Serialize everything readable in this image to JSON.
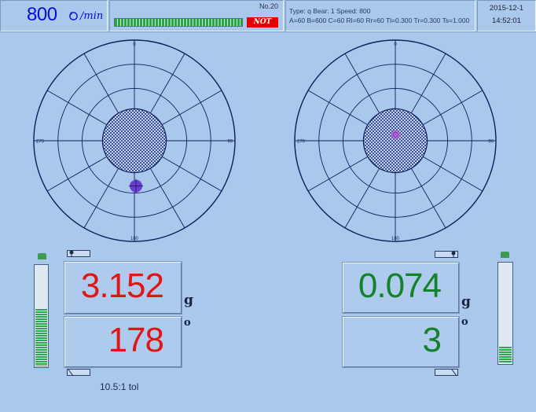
{
  "header": {
    "speed_value": "800",
    "speed_unit": "/min",
    "no_label": "No.20",
    "progress": 1.0,
    "status_badge": "NOT",
    "info_line1": "Type: q      Bear: 1      Speed: 800",
    "info_line2": "A=60 B=600 C=60 Rl=60 Rr=60 Tl=0.300 Tr=0.300 Ts=1.000",
    "date": "2015-12-1",
    "time": "14:52:01"
  },
  "left_plane": {
    "labels": {
      "top": "0",
      "right": "90",
      "bottom": "180",
      "left": "270"
    },
    "amount": "3.152",
    "angle": "178",
    "amount_unit": "g",
    "angle_unit": "o",
    "meter_level": 0.58,
    "marker": {
      "angle_deg": 178,
      "radius_fraction": 0.45
    },
    "tolerance_label": "10.5:1 tol"
  },
  "right_plane": {
    "labels": {
      "top": "0",
      "right": "90",
      "bottom": "180",
      "left": "270"
    },
    "amount": "0.074",
    "angle": "3",
    "amount_unit": "g",
    "angle_unit": "o",
    "meter_level": 0.18,
    "marker": {
      "angle_deg": 3,
      "radius_fraction": 0.06
    }
  },
  "colors": {
    "background": "#a9c8ec",
    "polar_lines": "#0f1f5c",
    "amount_left": "#e01515",
    "amount_right": "#13822a",
    "marker": "#6a3dd8",
    "badge": "#e80000"
  }
}
